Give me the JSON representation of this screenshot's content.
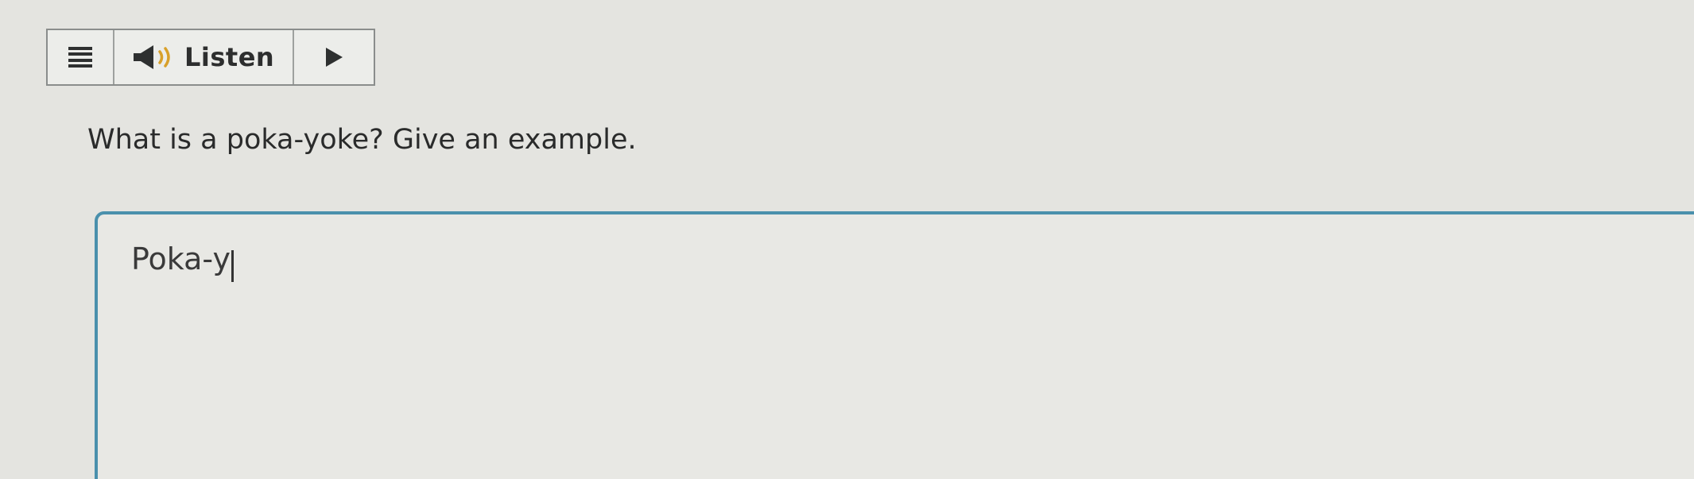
{
  "toolbar": {
    "menu_icon": "hamburger-menu-icon",
    "speaker_icon": "speaker-icon",
    "listen_label": "Listen",
    "play_icon": "play-icon"
  },
  "question": {
    "text": "What is a poka-yoke? Give an example."
  },
  "answer": {
    "value": "Poka-y"
  },
  "colors": {
    "background": "#e4e4e0",
    "answer_border": "#4a90ac",
    "toolbar_border": "#8a8d8c"
  }
}
